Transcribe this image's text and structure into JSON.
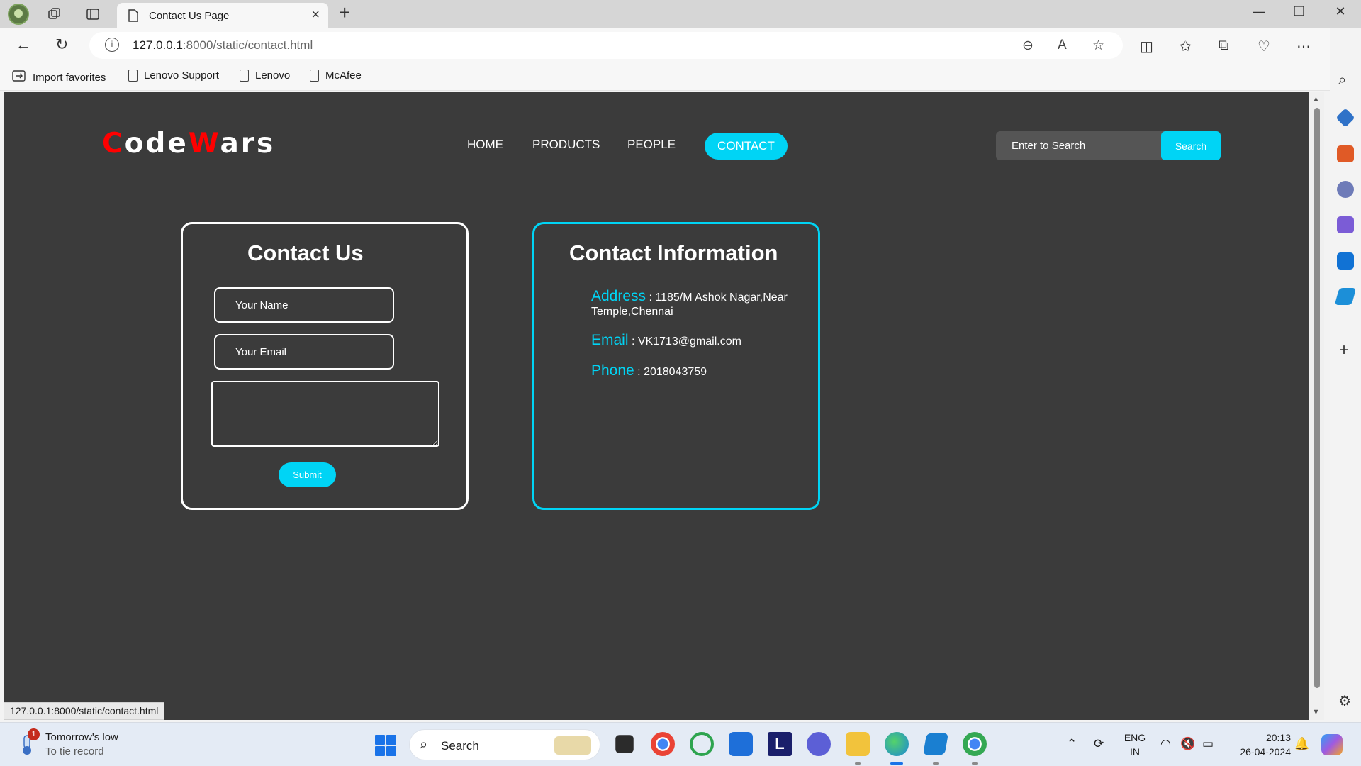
{
  "browser": {
    "tab_title": "Contact Us Page",
    "url_host": "127.0.0.1",
    "url_rest": ":8000/static/contact.html",
    "favorites": [
      "Import favorites",
      "Lenovo Support",
      "Lenovo",
      "McAfee"
    ],
    "status_url": "127.0.0.1:8000/static/contact.html"
  },
  "site": {
    "logo": {
      "c": "C",
      "ode": "ode",
      "w": "W",
      "ars": "ars"
    },
    "nav": [
      "HOME",
      "PRODUCTS",
      "PEOPLE",
      "CONTACT"
    ],
    "search_placeholder": "Enter to Search",
    "search_button": "Search",
    "accent_color": "#00d4f5",
    "logo_color": "#ff0000"
  },
  "contact_form": {
    "heading": "Contact Us",
    "name_placeholder": "Your Name",
    "email_placeholder": "Your Email",
    "submit": "Submit"
  },
  "contact_info": {
    "heading": "Contact Information",
    "address_label": "Address",
    "address_value": "1185/M Ashok Nagar,Near Temple,Chennai",
    "email_label": "Email",
    "email_value": "VK1713@gmail.com",
    "phone_label": "Phone",
    "phone_value": "2018043759",
    "separator": " : "
  },
  "taskbar": {
    "weather_badge": "1",
    "weather_title": "Tomorrow's low",
    "weather_sub": "To tie record",
    "search": "Search",
    "lang_top": "ENG",
    "lang_bottom": "IN",
    "time": "20:13",
    "date": "26-04-2024",
    "app_letter": "L"
  }
}
